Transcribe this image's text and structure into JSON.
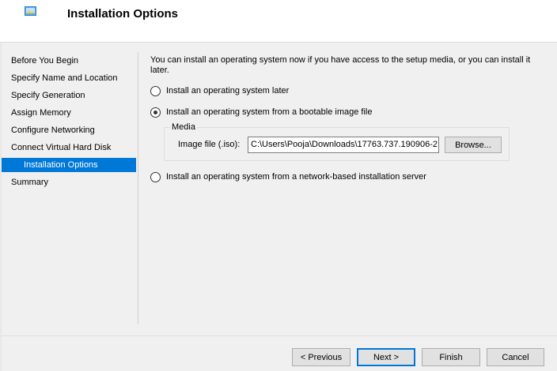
{
  "header": {
    "title": "Installation Options",
    "icon": "wizard-app-icon"
  },
  "sidebar": {
    "items": [
      {
        "label": "Before You Begin",
        "selected": false
      },
      {
        "label": "Specify Name and Location",
        "selected": false
      },
      {
        "label": "Specify Generation",
        "selected": false
      },
      {
        "label": "Assign Memory",
        "selected": false
      },
      {
        "label": "Configure Networking",
        "selected": false
      },
      {
        "label": "Connect Virtual Hard Disk",
        "selected": false
      },
      {
        "label": "Installation Options",
        "selected": true
      },
      {
        "label": "Summary",
        "selected": false
      }
    ]
  },
  "main": {
    "intro": "You can install an operating system now if you have access to the setup media, or you can install it later.",
    "options": [
      {
        "label": "Install an operating system later",
        "checked": false
      },
      {
        "label": "Install an operating system from a bootable image file",
        "checked": true
      },
      {
        "label": "Install an operating system from a network-based installation server",
        "checked": false
      }
    ],
    "media": {
      "legend": "Media",
      "image_label": "Image file (.iso):",
      "image_value": "C:\\Users\\Pooja\\Downloads\\17763.737.190906-2",
      "browse_label": "Browse..."
    }
  },
  "footer": {
    "previous_label": "< Previous",
    "next_label": "Next >",
    "finish_label": "Finish",
    "cancel_label": "Cancel"
  },
  "colors": {
    "selection": "#0078d7",
    "header_bg": "#ffffff",
    "body_bg": "#f0f0f0"
  }
}
